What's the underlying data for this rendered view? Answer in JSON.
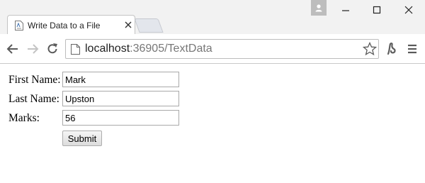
{
  "browser": {
    "tab": {
      "title": "Write Data to a File"
    },
    "address": {
      "host": "localhost",
      "rest": ":36905/TextData"
    }
  },
  "form": {
    "first_name": {
      "label": "First Name:",
      "value": "Mark"
    },
    "last_name": {
      "label": "Last Name:",
      "value": "Upston"
    },
    "marks": {
      "label": "Marks:",
      "value": "56"
    },
    "submit_label": "Submit"
  },
  "icons": {
    "user": "user-icon",
    "minimize": "minimize-icon",
    "maximize": "maximize-icon",
    "close": "close-icon",
    "back": "back-arrow-icon",
    "forward": "forward-arrow-icon",
    "reload": "reload-icon",
    "page": "page-icon",
    "bookmark": "star-icon",
    "extension": "extension-icon",
    "menu": "menu-icon"
  }
}
